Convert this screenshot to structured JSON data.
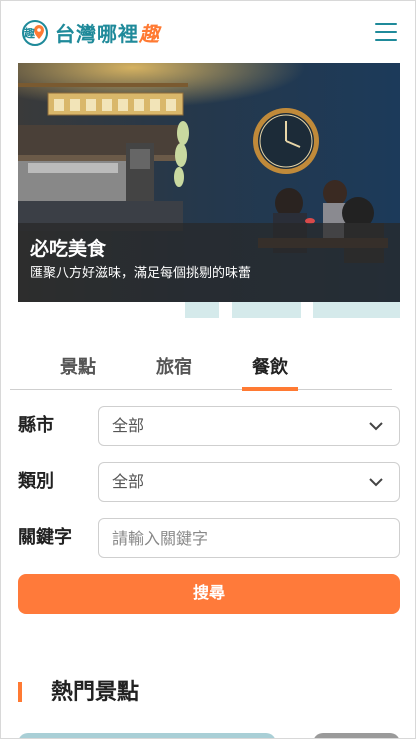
{
  "header": {
    "logo_text": "台灣哪裡",
    "logo_accent": "趣",
    "logo_mark": "趣",
    "brand_color": "#1f8a9a",
    "accent_color": "#ff7a33"
  },
  "hero": {
    "title": "必吃美食",
    "subtitle": "匯聚八方好滋味，滿足每個挑剔的味蕾"
  },
  "tabs": [
    {
      "label": "景點",
      "active": false
    },
    {
      "label": "旅宿",
      "active": false
    },
    {
      "label": "餐飲",
      "active": true
    }
  ],
  "form": {
    "city_label": "縣市",
    "city_value": "全部",
    "category_label": "類別",
    "category_value": "全部",
    "keyword_label": "關鍵字",
    "keyword_placeholder": "請輸入關鍵字",
    "search_label": "搜尋"
  },
  "popular": {
    "title": "熱門景點"
  }
}
